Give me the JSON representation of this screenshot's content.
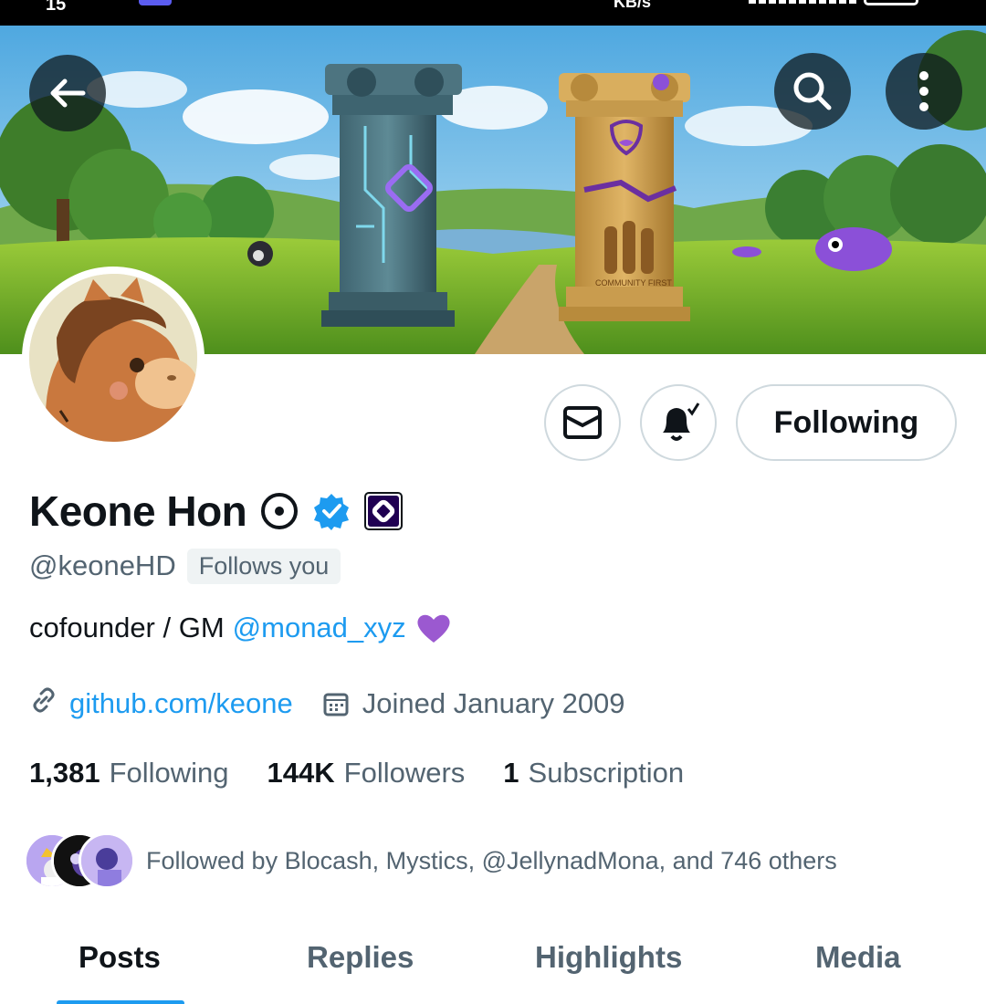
{
  "status_bar": {
    "time": "15",
    "speed": "KB/s"
  },
  "banner": {
    "pillar_text": "COMMUNITY FIRST",
    "icons": {
      "back": "arrow-left-icon",
      "search": "search-icon",
      "more": "more-vertical-icon"
    }
  },
  "actions": {
    "message_icon": "mail-icon",
    "notify_icon": "bell-check-icon",
    "following_label": "Following"
  },
  "profile": {
    "display_name": "Keone Hon",
    "badges": [
      "circle-dot-icon",
      "verified-badge-icon",
      "affiliate-logo-icon"
    ],
    "handle": "@keoneHD",
    "follows_you": "Follows you",
    "bio_text": "cofounder / GM",
    "bio_mention": "@monad_xyz",
    "bio_emoji": "purple-heart-icon",
    "website": "github.com/keone",
    "joined": "Joined January 2009"
  },
  "stats": {
    "following_count": "1,381",
    "following_label": "Following",
    "followers_count": "144K",
    "followers_label": "Followers",
    "subscriptions_count": "1",
    "subscriptions_label": "Subscription"
  },
  "followed_by": {
    "text": "Followed by Blocash, Mystics, @JellynadMona, and 746 others"
  },
  "tabs": [
    {
      "label": "Posts",
      "active": true
    },
    {
      "label": "Replies",
      "active": false
    },
    {
      "label": "Highlights",
      "active": false
    },
    {
      "label": "Media",
      "active": false
    }
  ],
  "colors": {
    "accent": "#1d9bf0",
    "text_primary": "#0f1419",
    "text_secondary": "#536471",
    "border": "#cfd9de",
    "monad_purple": "#7b3fe4"
  }
}
